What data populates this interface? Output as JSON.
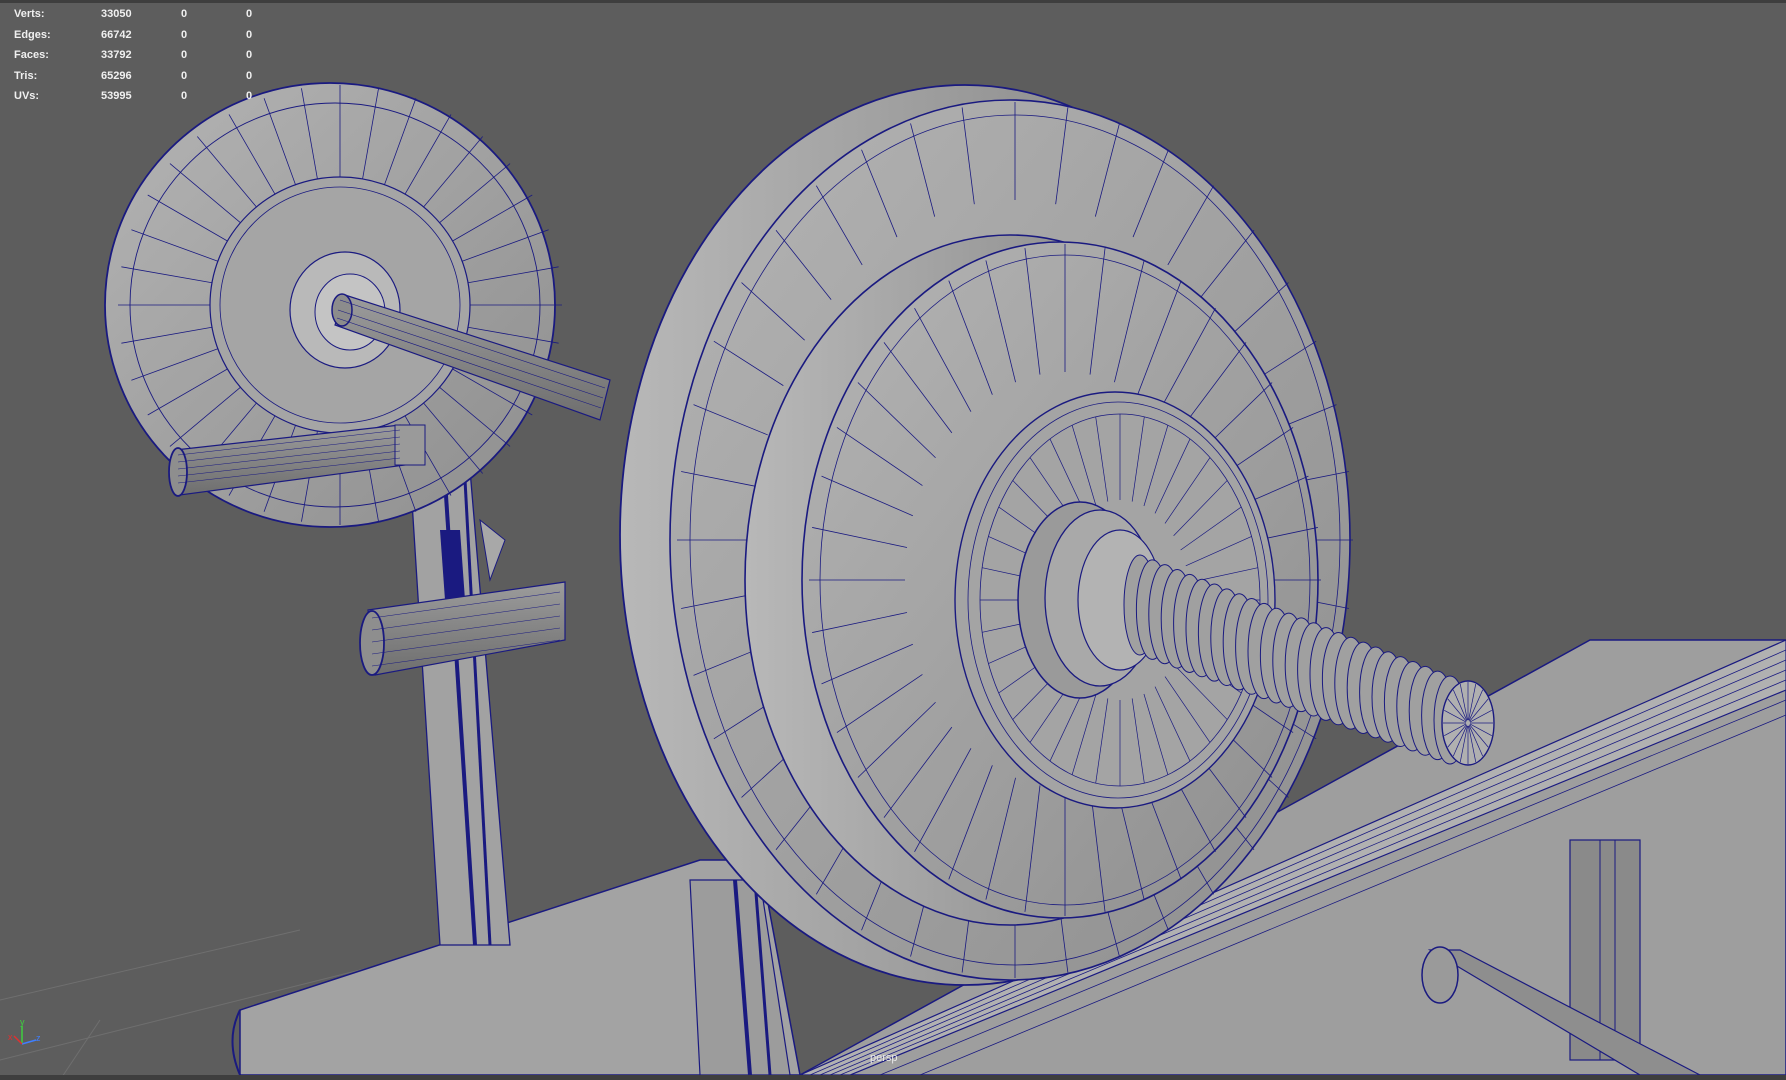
{
  "hud": {
    "rows": [
      {
        "label": "Verts:",
        "v1": "33050",
        "v2": "0",
        "v3": "0"
      },
      {
        "label": "Edges:",
        "v1": "66742",
        "v2": "0",
        "v3": "0"
      },
      {
        "label": "Faces:",
        "v1": "33792",
        "v2": "0",
        "v3": "0"
      },
      {
        "label": "Tris:",
        "v1": "65296",
        "v2": "0",
        "v3": "0"
      },
      {
        "label": "UVs:",
        "v1": "53995",
        "v2": "0",
        "v3": "0"
      }
    ]
  },
  "camera": {
    "name": "persp"
  },
  "axes": {
    "x": "x",
    "y": "y",
    "z": "z"
  },
  "colors": {
    "background": "#5d5d5d",
    "wire": "#1a1a80",
    "surface": "#a6a6a6",
    "hud_text": "#f0f0f0"
  },
  "scene": {
    "description_icon": "wireframe-barbell-bench-model"
  }
}
